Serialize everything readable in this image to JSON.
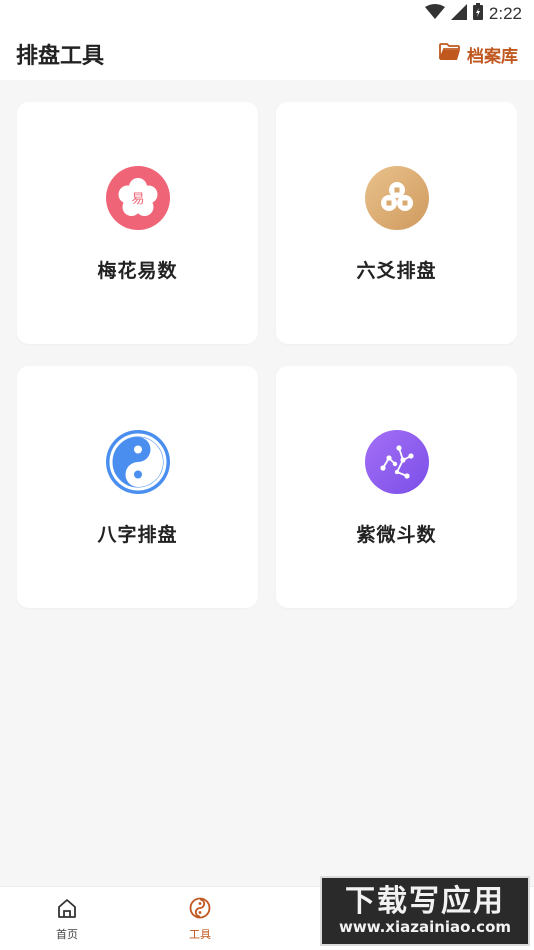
{
  "status_bar": {
    "time": "2:22",
    "icons": [
      "wifi-icon",
      "signal-icon",
      "battery-icon"
    ]
  },
  "header": {
    "title": "排盘工具",
    "archive_label": "档案库",
    "accent_color": "#c0571f"
  },
  "tools": [
    {
      "label": "梅花易数",
      "icon": "plum-blossom-icon",
      "icon_text": "易",
      "color": "#f06477"
    },
    {
      "label": "六爻排盘",
      "icon": "coins-icon",
      "color": "#d9aa70"
    },
    {
      "label": "八字排盘",
      "icon": "yin-yang-icon",
      "color": "#4a8ff0"
    },
    {
      "label": "紫微斗数",
      "icon": "constellation-icon",
      "color": "#8a5cf0"
    }
  ],
  "bottom_nav": {
    "items": [
      {
        "label": "首页",
        "icon": "home-icon",
        "active": false
      },
      {
        "label": "工具",
        "icon": "tools-icon",
        "active": true
      }
    ],
    "active_color": "#c0571f",
    "inactive_color": "#444444"
  },
  "watermark": {
    "text": "下载写应用",
    "url": "www.xiazainiao.com"
  }
}
